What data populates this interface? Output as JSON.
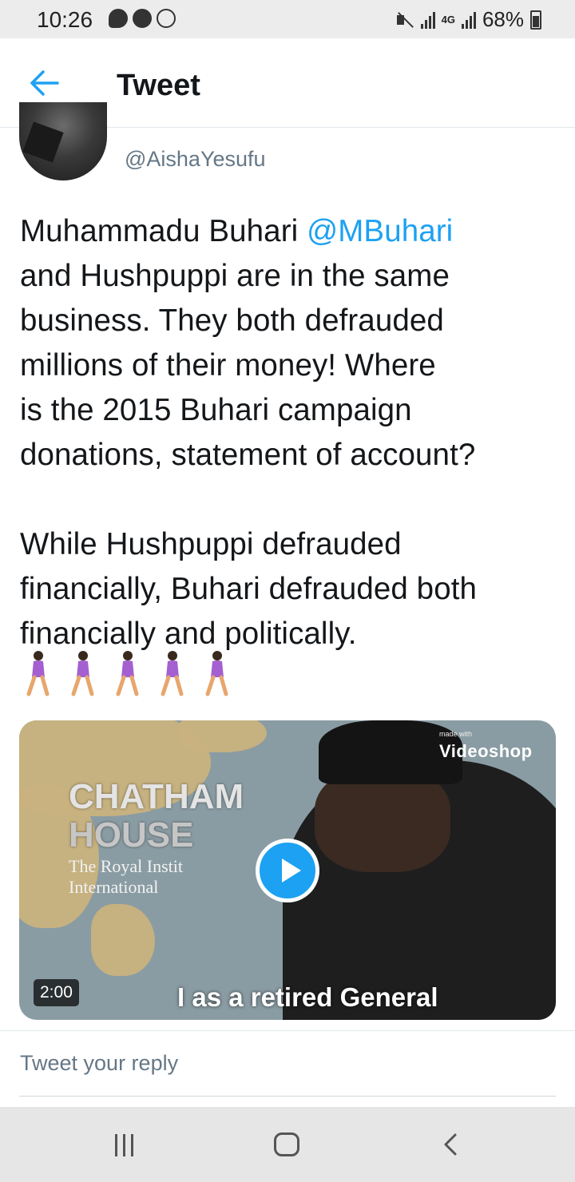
{
  "status_bar": {
    "time": "10:26",
    "network_label_top": "4G",
    "battery": "68%"
  },
  "header": {
    "title": "Tweet"
  },
  "tweet": {
    "handle": "@AishaYesufu",
    "lines": [
      {
        "pre": "Muhammadu Buhari ",
        "mention": "@MBuhari",
        "post": ""
      },
      {
        "pre": "and Hushpuppi are in the same",
        "mention": "",
        "post": ""
      },
      {
        "pre": "business. They both  defrauded",
        "mention": "",
        "post": ""
      },
      {
        "pre": "millions of their money! Where",
        "mention": "",
        "post": ""
      },
      {
        "pre": "is the 2015 Buhari campaign",
        "mention": "",
        "post": ""
      },
      {
        "pre": "donations, statement of account?",
        "mention": "",
        "post": ""
      }
    ],
    "paragraph2": [
      "While Hushpuppi defrauded",
      "financially, Buhari defrauded both",
      "financially and politically."
    ],
    "emoji_icons": [
      "woman-walking-icon",
      "woman-walking-icon",
      "woman-walking-icon",
      "woman-walking-icon",
      "woman-walking-icon"
    ]
  },
  "media": {
    "watermark_small": "made with",
    "watermark_brand": "Videoshop",
    "venue_line1": "CHATHAM",
    "venue_line2": "HOUSE",
    "venue_sub1": "The Royal Instit",
    "venue_sub2": "International",
    "duration": "2:00",
    "subtitle": "I as a retired General"
  },
  "reply": {
    "placeholder": "Tweet your reply"
  },
  "colors": {
    "accent": "#1da1f2",
    "text": "#14171a",
    "muted": "#657786"
  }
}
